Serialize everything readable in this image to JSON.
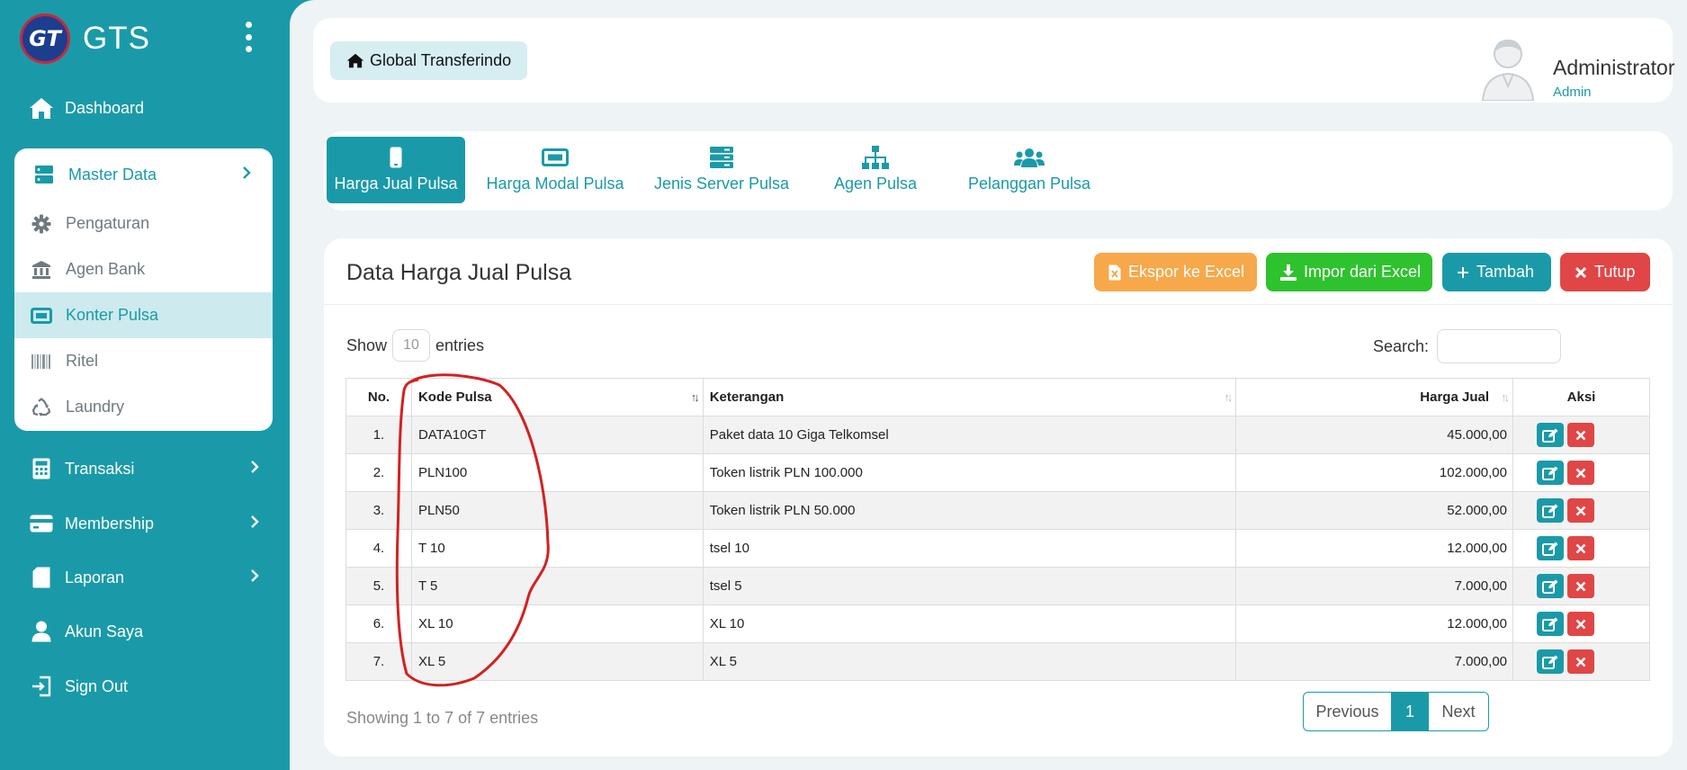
{
  "app": {
    "name": "GTS",
    "logo_text": "GT"
  },
  "sidebar": {
    "dashboard": "Dashboard",
    "master_data": {
      "label": "Master Data",
      "items": [
        {
          "label": "Pengaturan",
          "icon": "gear-icon"
        },
        {
          "label": "Agen Bank",
          "icon": "bank-icon"
        },
        {
          "label": "Konter Pulsa",
          "icon": "ticket-icon",
          "active": true
        },
        {
          "label": "Ritel",
          "icon": "barcode-icon"
        },
        {
          "label": "Laundry",
          "icon": "recycle-icon"
        }
      ]
    },
    "transaksi": "Transaksi",
    "membership": "Membership",
    "laporan": "Laporan",
    "akun_saya": "Akun Saya",
    "sign_out": "Sign Out"
  },
  "topbar": {
    "breadcrumb": "Global Transferindo",
    "user_name": "Administrator",
    "user_role": "Admin"
  },
  "tabs": [
    {
      "label": "Harga Jual Pulsa",
      "icon": "mobile-icon",
      "active": true
    },
    {
      "label": "Harga Modal Pulsa",
      "icon": "ticket-icon"
    },
    {
      "label": "Jenis Server Pulsa",
      "icon": "server-icon"
    },
    {
      "label": "Agen Pulsa",
      "icon": "sitemap-icon"
    },
    {
      "label": "Pelanggan Pulsa",
      "icon": "users-icon"
    }
  ],
  "card": {
    "title": "Data Harga Jual Pulsa",
    "buttons": {
      "export": "Ekspor ke Excel",
      "import": "Impor dari Excel",
      "add": "Tambah",
      "close": "Tutup"
    },
    "show_label": "Show",
    "entries_label": "entries",
    "page_length": "10",
    "search_label": "Search:",
    "search_value": ""
  },
  "table": {
    "headers": {
      "no": "No.",
      "kode": "Kode Pulsa",
      "ket": "Keterangan",
      "harga": "Harga Jual",
      "aksi": "Aksi"
    },
    "rows": [
      {
        "no": "1.",
        "kode": "DATA10GT",
        "ket": "Paket data 10 Giga Telkomsel",
        "harga": "45.000,00"
      },
      {
        "no": "2.",
        "kode": "PLN100",
        "ket": "Token listrik PLN 100.000",
        "harga": "102.000,00"
      },
      {
        "no": "3.",
        "kode": "PLN50",
        "ket": "Token listrik PLN 50.000",
        "harga": "52.000,00"
      },
      {
        "no": "4.",
        "kode": "T 10",
        "ket": "tsel 10",
        "harga": "12.000,00"
      },
      {
        "no": "5.",
        "kode": "T 5",
        "ket": "tsel 5",
        "harga": "7.000,00"
      },
      {
        "no": "6.",
        "kode": "XL 10",
        "ket": "XL 10",
        "harga": "12.000,00"
      },
      {
        "no": "7.",
        "kode": "XL 5",
        "ket": "XL 5",
        "harga": "7.000,00"
      }
    ]
  },
  "footer": {
    "info": "Showing 1 to 7 of 7 entries",
    "previous": "Previous",
    "page": "1",
    "next": "Next"
  },
  "colors": {
    "primary": "#1a9aa8",
    "excel": "#f7a84a",
    "import": "#2ec22e",
    "danger": "#e04646",
    "annotation": "#d42020"
  }
}
